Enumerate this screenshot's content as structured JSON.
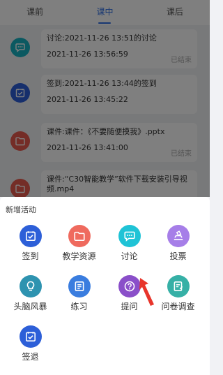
{
  "tabs": [
    {
      "label": "课前"
    },
    {
      "label": "课中"
    },
    {
      "label": "课后"
    }
  ],
  "activities": [
    {
      "icon": "discussion-icon",
      "color": "#17b3c2",
      "title": "讨论:2021-11-26 13:51的讨论",
      "time": "2021-11-26 13:56:59",
      "status": "已结束"
    },
    {
      "icon": "signin-icon",
      "color": "#2d5fd8",
      "title": "签到:2021-11-26 13:44的签到",
      "time": "2021-11-26 13:45:22",
      "status": ""
    },
    {
      "icon": "folder-icon",
      "color": "#e85a4f",
      "title": "课件:课件：《不要随便摸我》.pptx",
      "time": "2021-11-26 13:41:00",
      "status": "已结束"
    },
    {
      "icon": "folder-icon",
      "color": "#e85a4f",
      "title": "课件:“C30智能教学”软件下载安装引导视频.mp4",
      "time": "",
      "status": ""
    }
  ],
  "sheet": {
    "title": "新增活动",
    "items": [
      {
        "label": "签到",
        "icon": "signin-icon",
        "color": "#2d5fd8"
      },
      {
        "label": "教学资源",
        "icon": "folder-icon",
        "color": "#ef6a5e"
      },
      {
        "label": "讨论",
        "icon": "discussion-icon",
        "color": "#1fc3d6"
      },
      {
        "label": "投票",
        "icon": "vote-icon",
        "color": "#a67ee8"
      },
      {
        "label": "头脑风暴",
        "icon": "lightbulb-icon",
        "color": "#2e93b0"
      },
      {
        "label": "练习",
        "icon": "exercise-icon",
        "color": "#3a7ddf"
      },
      {
        "label": "提问",
        "icon": "question-icon",
        "color": "#8a4fc9"
      },
      {
        "label": "问卷调查",
        "icon": "survey-icon",
        "color": "#36b0a6"
      },
      {
        "label": "签退",
        "icon": "signout-icon",
        "color": "#2d5fd8"
      }
    ]
  }
}
